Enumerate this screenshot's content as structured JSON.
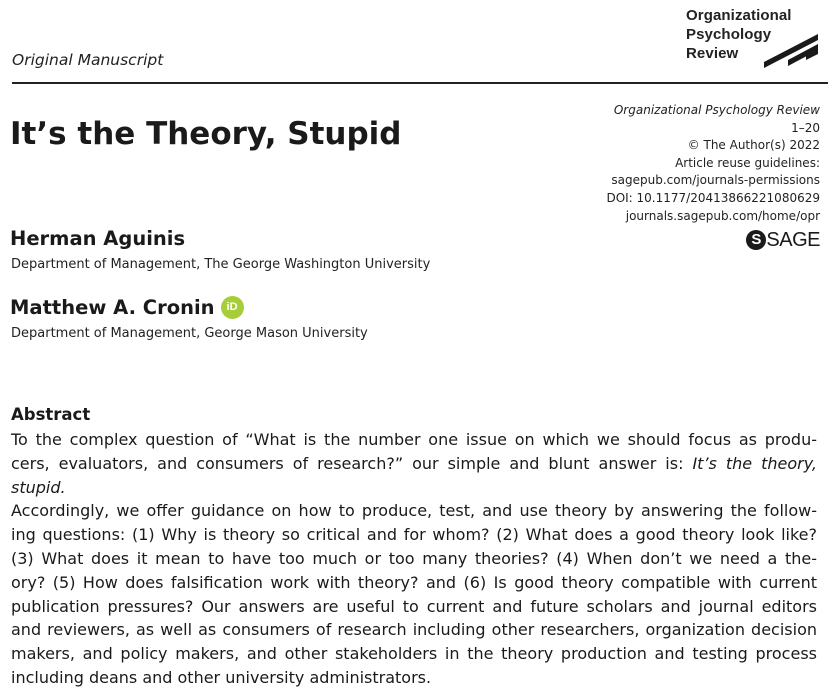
{
  "header": {
    "logo_lines": [
      "Organizational",
      "Psychology",
      "Review"
    ],
    "manuscript_type": "Original Manuscript"
  },
  "article": {
    "title": "It’s the Theory, Stupid"
  },
  "meta": {
    "journal": "Organizational Psychology Review",
    "pages": "1–20",
    "copyright": "© The Author(s) 2022",
    "reuse": "Article reuse guidelines:",
    "permissions_url": "sagepub.com/journals-permissions",
    "doi": "DOI: 10.1177/20413866221080629",
    "home_url": "journals.sagepub.com/home/opr",
    "publisher": "SAGE",
    "publisher_mark": "S"
  },
  "authors": [
    {
      "name": "Herman Aguinis",
      "affiliation": "Department of Management, The George Washington University"
    },
    {
      "name": "Matthew A. Cronin",
      "affiliation": "Department of Management, George Mason University",
      "orcid_badge": "iD"
    }
  ],
  "abstract": {
    "heading": "Abstract",
    "lines": [
      "To the complex question of “What is the number one issue on which we should focus as produ-",
      "cers, evaluators, and consumers of research?” our simple and blunt answer is: ",
      "Accordingly, we offer guidance on how to produce, test, and use theory by answering the follow-",
      "ing questions: (1) Why is theory so critical and for whom? (2) What does a good theory look like?",
      "(3) What does it mean to have too much or too many theories? (4) When don’t we need a the-",
      "ory? (5) How does falsification work with theory? and (6) Is good theory compatible with current",
      "publication pressures? Our answers are useful to current and future scholars and journal editors",
      "and reviewers, as well as consumers of research including other researchers, organization decision",
      "makers, and policy makers, and other stakeholders in the theory production and testing process",
      "including deans and other university administrators."
    ],
    "emphasis": "It’s the theory, stupid."
  },
  "colors": {
    "text": "#1a1a1a",
    "orcid": "#a6ce39",
    "rule": "#222222"
  }
}
